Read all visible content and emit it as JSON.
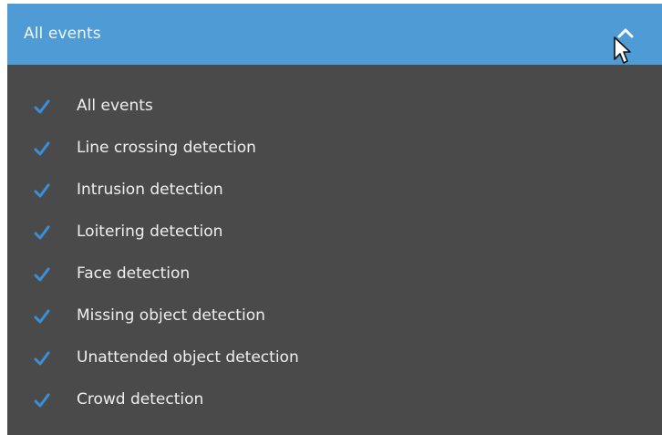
{
  "dropdown": {
    "selected_label": "All events",
    "expanded": true,
    "toggle_icon": "chevron-up-icon",
    "option_icon": "checkmark-icon",
    "colors": {
      "header_background": "#4f9bd6",
      "list_background": "#4a4a4a",
      "checkmark": "#3a8fd9",
      "text": "#efefef"
    },
    "options": [
      {
        "label": "All events",
        "checked": true
      },
      {
        "label": "Line crossing detection",
        "checked": true
      },
      {
        "label": "Intrusion detection",
        "checked": true
      },
      {
        "label": "Loitering detection",
        "checked": true
      },
      {
        "label": "Face detection",
        "checked": true
      },
      {
        "label": "Missing object detection",
        "checked": true
      },
      {
        "label": "Unattended object detection",
        "checked": true
      },
      {
        "label": "Crowd detection",
        "checked": true
      }
    ]
  }
}
